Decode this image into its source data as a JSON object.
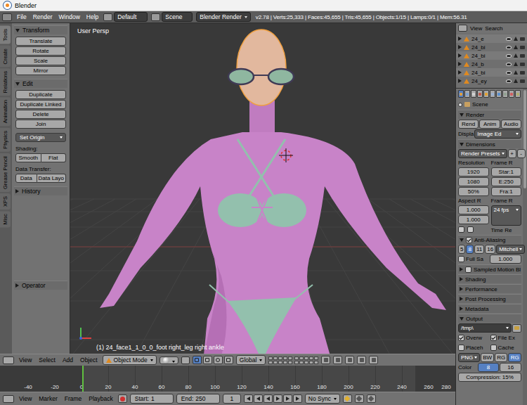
{
  "window": {
    "title": "Blender"
  },
  "menubar": {
    "menus": [
      "File",
      "Render",
      "Window",
      "Help"
    ],
    "layout": "Default",
    "scene": "Scene",
    "engine": "Blender Render",
    "stats": "v2.78 | Verts:25,333 | Faces:45,655 | Tris:45,655 | Objects:1/15 | Lamps:0/1 | Mem:56.31"
  },
  "toolshelf": {
    "tabs": [
      {
        "label": "Tools",
        "selected": true
      },
      {
        "label": "Create",
        "selected": false
      },
      {
        "label": "Relations",
        "selected": false
      },
      {
        "label": "Animation",
        "selected": false
      },
      {
        "label": "Physics",
        "selected": false
      },
      {
        "label": "Grease Pencil",
        "selected": false
      },
      {
        "label": "XPS",
        "selected": false
      },
      {
        "label": "Misc",
        "selected": false
      }
    ],
    "panels": [
      {
        "title": "Transform",
        "expanded": true,
        "rows": [
          {
            "kind": "button",
            "labels": [
              "Translate"
            ]
          },
          {
            "kind": "button",
            "labels": [
              "Rotate"
            ]
          },
          {
            "kind": "button",
            "labels": [
              "Scale"
            ]
          },
          {
            "kind": "button",
            "labels": [
              "Mirror"
            ]
          }
        ]
      },
      {
        "title": "Edit",
        "expanded": true,
        "rows": [
          {
            "kind": "button",
            "labels": [
              "Duplicate"
            ]
          },
          {
            "kind": "button",
            "labels": [
              "Duplicate Linked"
            ]
          },
          {
            "kind": "button",
            "labels": [
              "Delete"
            ]
          },
          {
            "kind": "button",
            "labels": [
              "Join"
            ]
          },
          {
            "kind": "dropdown",
            "labels": [
              "Set Origin"
            ]
          },
          {
            "kind": "label",
            "labels": [
              "Shading:"
            ]
          },
          {
            "kind": "pair",
            "labels": [
              "Smooth",
              "Flat"
            ]
          },
          {
            "kind": "label",
            "labels": [
              "Data Transfer:"
            ]
          },
          {
            "kind": "pair",
            "labels": [
              "Data",
              "Data Layo"
            ]
          }
        ]
      },
      {
        "title": "History",
        "expanded": false,
        "rows": []
      },
      {
        "title": "Operator",
        "expanded": false,
        "rows": []
      }
    ]
  },
  "viewport": {
    "view_label": "User Persp",
    "object_info": "(1) 24_face1_1_0_0_foot right_leg right ankle"
  },
  "viewport_header": {
    "menus": [
      "View",
      "Select",
      "Add",
      "Object"
    ],
    "mode": "Object Mode",
    "orientation": "Global"
  },
  "timeline": {
    "ticks": [
      "-40",
      "-20",
      "0",
      "20",
      "40",
      "60",
      "80",
      "100",
      "120",
      "140",
      "160",
      "180",
      "200",
      "220",
      "240",
      "260",
      "280"
    ]
  },
  "timeline_header": {
    "menus": [
      "View",
      "Marker",
      "Frame",
      "Playback"
    ],
    "start_label": "Start:",
    "start": "1",
    "end_label": "End:",
    "end": "250",
    "frame": "1",
    "sync": "No Sync"
  },
  "outliner": {
    "menus": [
      "View",
      "Search"
    ],
    "items": [
      {
        "name": "24_e"
      },
      {
        "name": "24_bi"
      },
      {
        "name": "24_bi"
      },
      {
        "name": "24_b"
      },
      {
        "name": "24_bi"
      },
      {
        "name": "24_ey"
      }
    ]
  },
  "properties": {
    "context": "Scene",
    "render": {
      "title": "Render",
      "expanded": true,
      "buttons": [
        "Rend",
        "Anim",
        "Audio"
      ],
      "display_label": "Displa",
      "display": "Image Ed"
    },
    "dimensions": {
      "title": "Dimensions",
      "expanded": true,
      "presets": "Render Presets",
      "add": "+",
      "remove": "-",
      "resolution_label": "Resolution",
      "res_x": "1920",
      "res_y": "1080",
      "percent": "50%",
      "percent_level": 0.5,
      "range_label": "Frame R",
      "start": "Star:1",
      "end": "E:250",
      "step": "Fra:1",
      "aspect_label": "Aspect R",
      "aspect_x": "1.000",
      "aspect_y": "1.000",
      "rate_label": "Frame R",
      "fps": "24 fps",
      "remap": "Time Re",
      "border": false,
      "crop": false
    },
    "antialiasing": {
      "title": "Anti-Aliasing",
      "expanded": true,
      "checked": true,
      "samples": [
        {
          "label": "5",
          "selected": false
        },
        {
          "label": "8",
          "selected": true
        },
        {
          "label": "11",
          "selected": false
        },
        {
          "label": "16",
          "selected": false
        }
      ],
      "filter": "Mitchell",
      "full_sample": {
        "label": "Full Sa",
        "checked": false
      },
      "size": "1.000"
    },
    "motion_blur": {
      "title": "Sampled Motion Bl",
      "expanded": false,
      "checked": false
    },
    "collapsed": [
      {
        "title": "Shading",
        "expanded": false
      },
      {
        "title": "Performance",
        "expanded": false
      },
      {
        "title": "Post Processing",
        "expanded": false
      },
      {
        "title": "Metadata",
        "expanded": false
      }
    ],
    "output": {
      "title": "Output",
      "expanded": true,
      "path": "/tmp\\",
      "options": [
        {
          "label": "Overw",
          "checked": true
        },
        {
          "label": "File Ex",
          "checked": true
        },
        {
          "label": "Placeh",
          "checked": false
        },
        {
          "label": "Cache",
          "checked": false
        }
      ],
      "format": "PNG",
      "color_modes": [
        {
          "label": "BW",
          "selected": false
        },
        {
          "label": "RG",
          "selected": false
        },
        {
          "label": "RG",
          "selected": true
        }
      ],
      "color_label": "Color",
      "depths": [
        {
          "label": "8",
          "selected": true
        },
        {
          "label": "16",
          "selected": false
        }
      ],
      "compression": "Compression: 15%",
      "compression_level": 0.15
    }
  }
}
